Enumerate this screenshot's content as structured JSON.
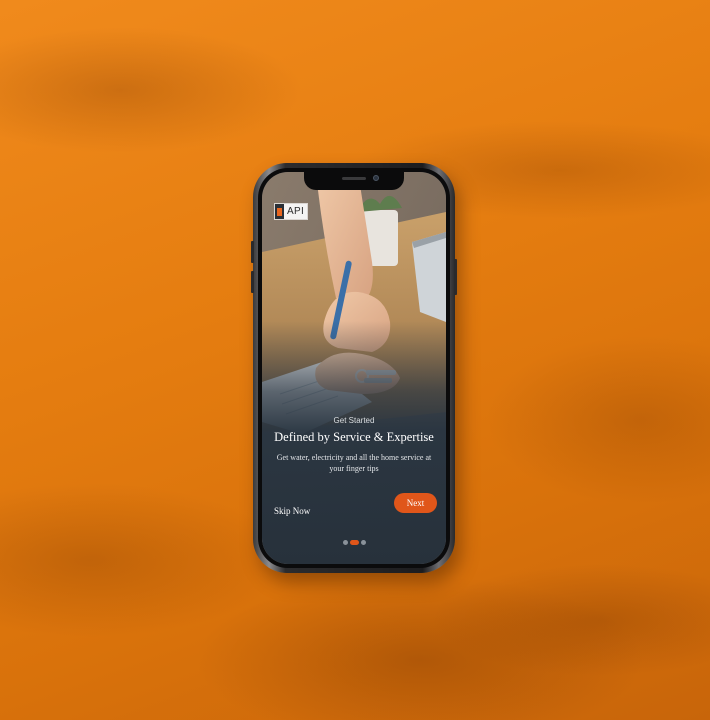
{
  "brand": {
    "logo_text": "API",
    "accent_color": "#e0561a"
  },
  "onboarding": {
    "eyebrow": "Get Started",
    "title": "Defined by Service & Expertise",
    "subtitle": "Get water, electricity and all the home service at your finger tips",
    "skip_label": "Skip Now",
    "next_label": "Next",
    "page_indicator": {
      "total": 3,
      "active": 2
    }
  },
  "background": {
    "color": "#e57d10",
    "hero_image": "hand-signing-document-with-keys"
  }
}
